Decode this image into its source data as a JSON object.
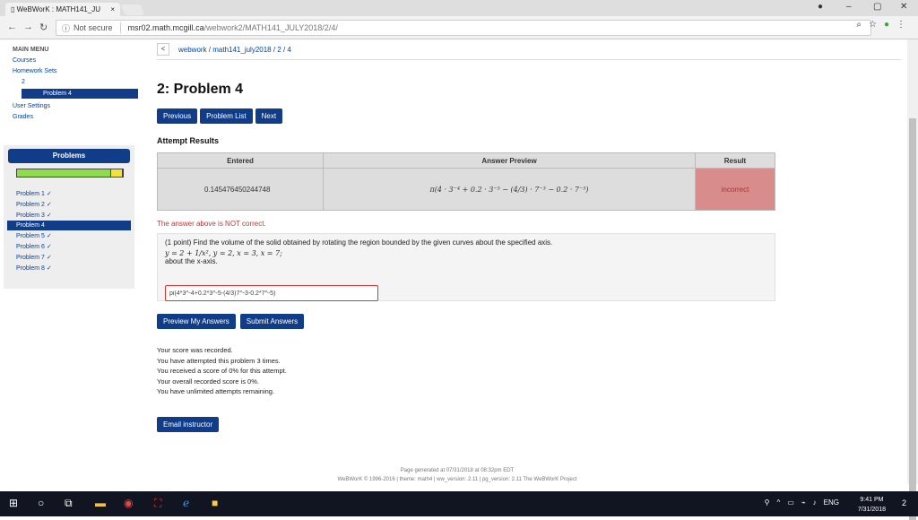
{
  "browser": {
    "tab_title": "WeBWorK : MATH141_JU",
    "tab_close": "×",
    "not_secure": "Not secure",
    "url_domain": "msr02.math.mcgill.ca",
    "url_path": "/webwork2/MATH141_JULY2018/2/4/"
  },
  "nav": {
    "main_menu": "MAIN MENU",
    "courses": "Courses",
    "homework_sets": "Homework Sets",
    "set_2": "2",
    "problem_4": "Problem 4",
    "user_settings": "User Settings",
    "grades": "Grades"
  },
  "problems_panel": {
    "title": "Problems",
    "progress_green": 0.88,
    "items": [
      "Problem 1 ✓",
      "Problem 2 ✓",
      "Problem 3 ✓",
      "Problem 4",
      "Problem 5 ✓",
      "Problem 6 ✓",
      "Problem 7 ✓",
      "Problem 8 ✓"
    ]
  },
  "breadcrumb": {
    "back": "<",
    "path": "webwork / math141_july2018 / 2 / 4"
  },
  "page_title": "2: Problem 4",
  "buttons": {
    "previous": "Previous",
    "problem_list": "Problem List",
    "next": "Next",
    "preview": "Preview My Answers",
    "submit": "Submit Answers",
    "email": "Email instructor"
  },
  "attempt": {
    "heading": "Attempt Results",
    "col_entered": "Entered",
    "col_preview": "Answer Preview",
    "col_result": "Result",
    "entered": "0.145476450244748",
    "preview": "π(4 · 3⁻⁴ + 0.2 · 3⁻⁵ − (4/3) · 7⁻³ − 0.2 · 7⁻⁵)",
    "result": "incorrect",
    "warning": "The answer above is NOT correct."
  },
  "problem": {
    "statement": "(1 point) Find the volume of the solid obtained by rotating the region bounded by the given curves about the specified axis.",
    "math": "y = 2 + 1/x², y = 2, x = 3, x = 7;",
    "axis": "about the x-axis.",
    "answer_value": "pi(4*3^-4+0.2*3^-5-(4/3)7^-3-0.2*7^-5)"
  },
  "score": {
    "line1": "Your score was recorded.",
    "line2": "You have attempted this problem 3 times.",
    "line3": "You received a score of 0% for this attempt.",
    "line4": "Your overall recorded score is 0%.",
    "line5": "You have unlimited attempts remaining."
  },
  "footer": {
    "line1": "Page generated at 07/31/2018 at 08:32pm EDT",
    "line2": "WeBWorK © 1996-2016 | theme: math4 | ww_version: 2.11 | pg_version: 2.11 The WeBWorK Project"
  },
  "taskbar": {
    "lang": "ENG",
    "time": "9:41 PM",
    "date": "7/31/2018",
    "notif_count": "2"
  }
}
